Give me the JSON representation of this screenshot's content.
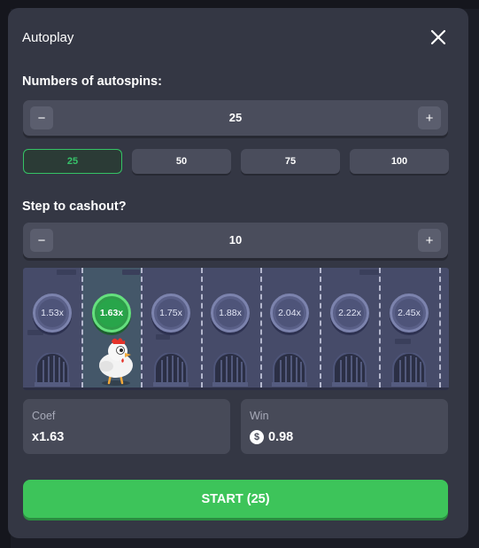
{
  "modal": {
    "title": "Autoplay"
  },
  "autospins": {
    "label": "Numbers of autospins:",
    "value": "25",
    "minus": "−",
    "plus": "+",
    "presets": [
      "25",
      "50",
      "75",
      "100"
    ],
    "selected_preset": "25"
  },
  "cashout": {
    "label": "Step to cashout?",
    "value": "10",
    "minus": "−",
    "plus": "+"
  },
  "track": {
    "multipliers": [
      "1.53x",
      "1.63x",
      "1.75x",
      "1.88x",
      "2.04x",
      "2.22x",
      "2.45x"
    ],
    "current_index": 1
  },
  "coef": {
    "label": "Coef",
    "value": "x1.63"
  },
  "win": {
    "label": "Win",
    "currency_symbol": "$",
    "value": "0.98"
  },
  "start_button": {
    "label": "START (25)"
  },
  "colors": {
    "accent_green": "#3dc45a",
    "panel": "#343744",
    "control": "#4a4d5c",
    "track": "#464b69"
  }
}
